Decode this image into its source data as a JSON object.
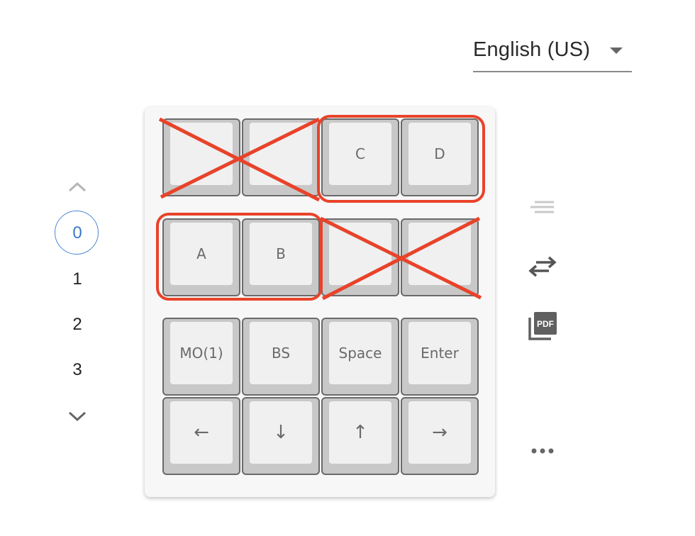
{
  "language": {
    "selected": "English (US)"
  },
  "layers": {
    "items": [
      "0",
      "1",
      "2",
      "3"
    ],
    "active_index": 0
  },
  "keyboard": {
    "rows": [
      [
        "",
        "",
        "C",
        "D"
      ],
      [
        "A",
        "B",
        "",
        ""
      ],
      [
        "MO(1)",
        "BS",
        "Space",
        "Enter"
      ],
      [
        "←",
        "↓",
        "↑",
        "→"
      ]
    ]
  },
  "toolbar": {
    "icons": [
      "text-align-icon",
      "swap-icon",
      "pdf-icon",
      "more-icon"
    ],
    "pdf_badge": "PDF"
  },
  "colors": {
    "accent": "#3b78c8",
    "annotation_red": "#e8432a",
    "key_border": "#6a6a6a"
  }
}
